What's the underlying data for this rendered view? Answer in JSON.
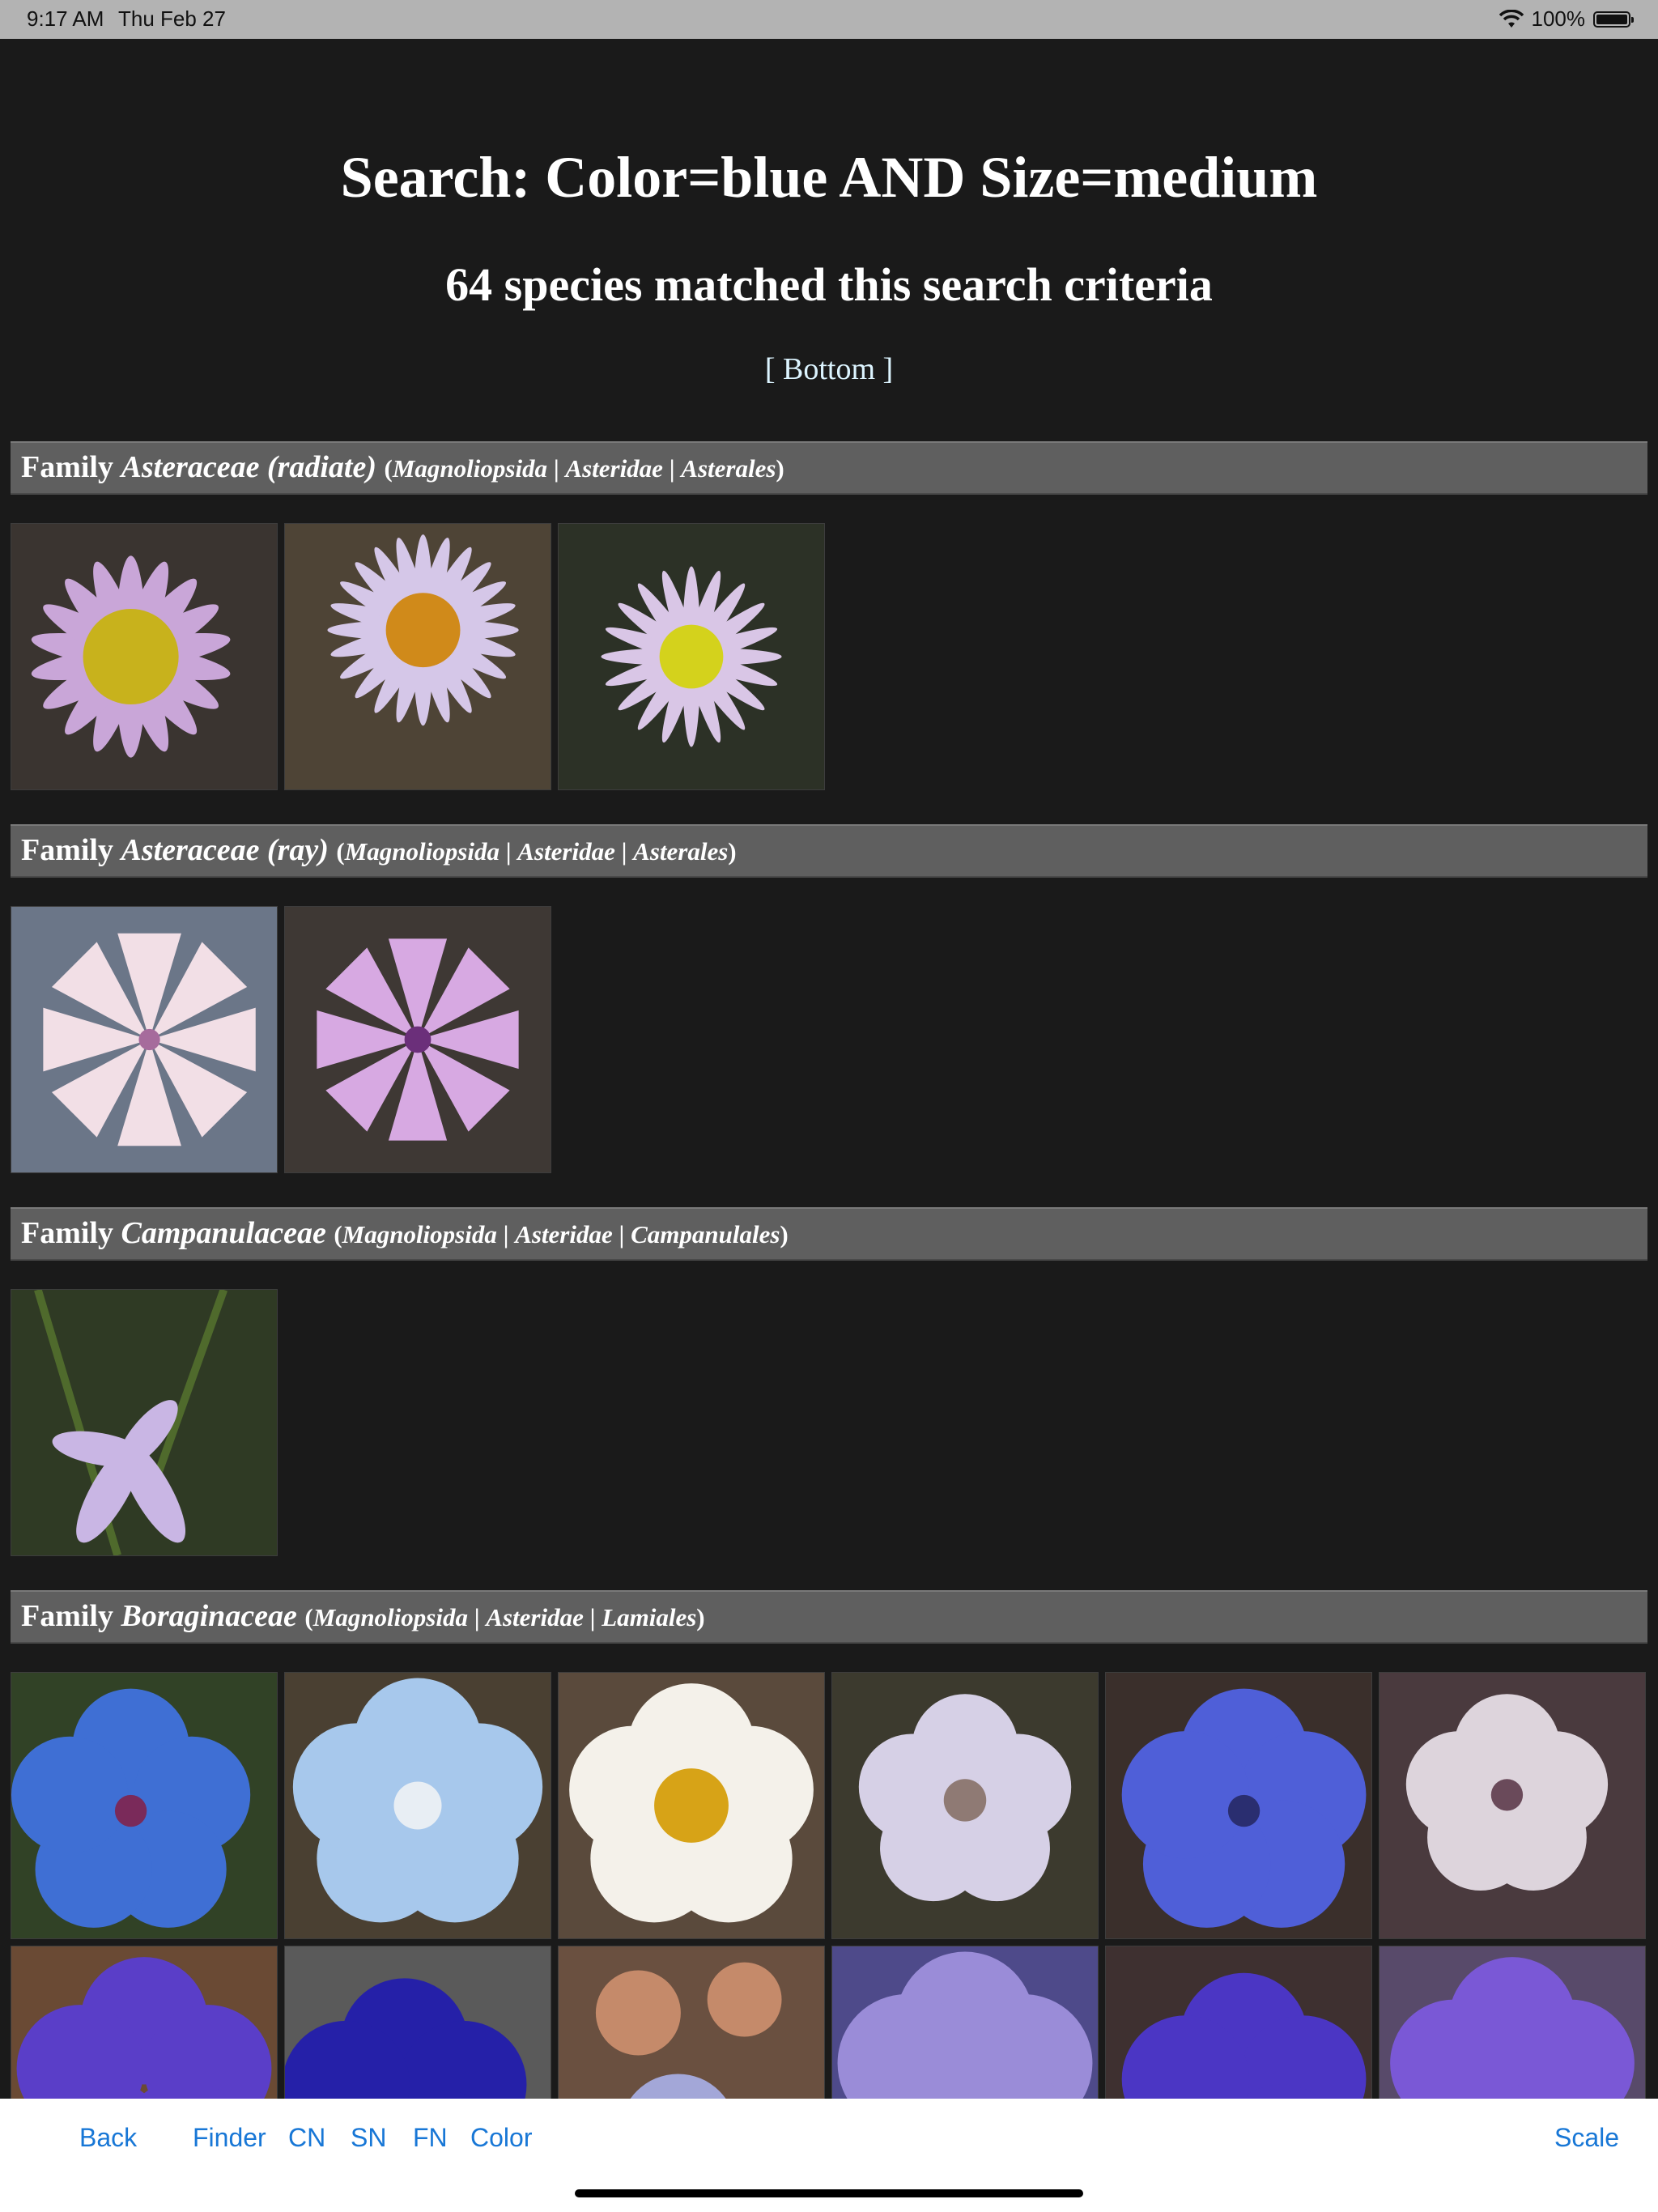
{
  "status_bar": {
    "time": "9:17 AM",
    "date": "Thu Feb 27",
    "battery_text": "100%"
  },
  "page": {
    "title": "Search: Color=blue AND Size=medium",
    "subtitle": "64 species matched this search criteria",
    "bottom_link": "[ Bottom ]"
  },
  "families": [
    {
      "label": "Family",
      "name": "Asteraceae (radiate)",
      "class": "Magnoliopsida",
      "sep1": "|",
      "subclass": "Asteridae",
      "sep2": "|",
      "order": "Asterales",
      "open": "(",
      "close": ")"
    },
    {
      "label": "Family",
      "name": "Asteraceae (ray)",
      "class": "Magnoliopsida",
      "sep1": "|",
      "subclass": "Asteridae",
      "sep2": "|",
      "order": "Asterales",
      "open": "(",
      "close": ")"
    },
    {
      "label": "Family",
      "name": "Campanulaceae",
      "class": "Magnoliopsida",
      "sep1": "|",
      "subclass": "Asteridae",
      "sep2": "|",
      "order": "Campanulales",
      "open": "(",
      "close": ")"
    },
    {
      "label": "Family",
      "name": "Boraginaceae",
      "class": "Magnoliopsida",
      "sep1": "|",
      "subclass": "Asteridae",
      "sep2": "|",
      "order": "Lamiales",
      "open": "(",
      "close": ")"
    }
  ],
  "toolbar": {
    "back": "Back",
    "finder": "Finder",
    "cn": "CN",
    "sn": "SN",
    "fn": "FN",
    "color": "Color",
    "scale": "Scale"
  },
  "colors": {
    "link": "#dcf4ff",
    "toolbar_text": "#1877d6",
    "header_bg": "#5f5f5f",
    "page_bg": "#1a1a1a"
  }
}
